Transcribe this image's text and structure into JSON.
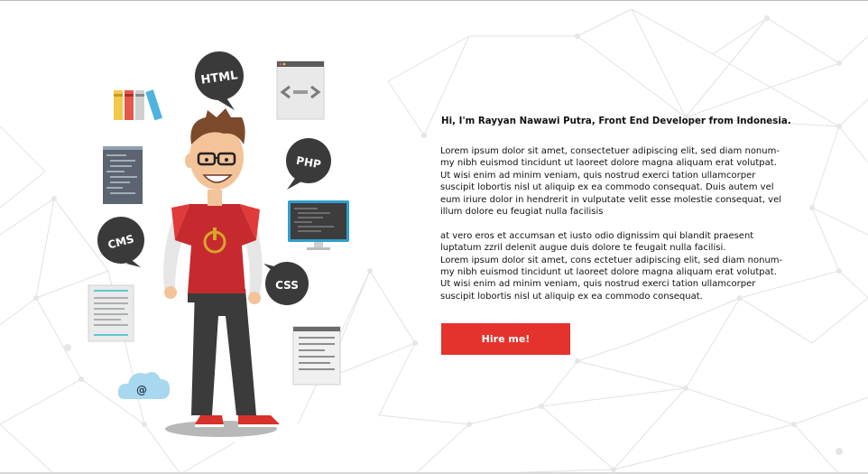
{
  "skills": {
    "html": "HTML",
    "php": "PHP",
    "cms": "CMS",
    "css": "CSS",
    "email_symbol": "@"
  },
  "intro": {
    "headline": "Hi, I'm Rayyan Nawawi Putra, Front End Developer from Indonesia.",
    "paragraph1": "Lorem ipsum dolor sit amet, consectetuer adipiscing elit, sed diam nonum-\nmy nibh euismod tincidunt ut laoreet dolore magna aliquam erat volutpat.\nUt wisi enim ad minim veniam, quis nostrud exerci tation ullamcorper\nsuscipit lobortis nisl ut aliquip ex ea commodo consequat. Duis autem vel\neum iriure dolor in hendrerit in vulputate velit esse molestie consequat, vel\nillum dolore eu feugiat nulla facilisis",
    "paragraph2": "at vero eros et accumsan et iusto odio dignissim qui blandit praesent\nluptatum zzril delenit augue duis dolore te feugait nulla facilisi.\nLorem ipsum dolor sit amet, cons ectetuer adipiscing elit, sed diam nonum-\nmy nibh euismod tincidunt ut laoreet dolore magna aliquam erat volutpat.\nUt wisi enim ad minim veniam, quis nostrud exerci tation ullamcorper\nsuscipit lobortis nisl ut aliquip ex ea commodo consequat.",
    "cta_label": "Hire me!"
  },
  "colors": {
    "accent": "#e5322d",
    "bubble": "#3a3a3a",
    "shirt": "#c62a2f",
    "network": "#e2e2e2"
  }
}
